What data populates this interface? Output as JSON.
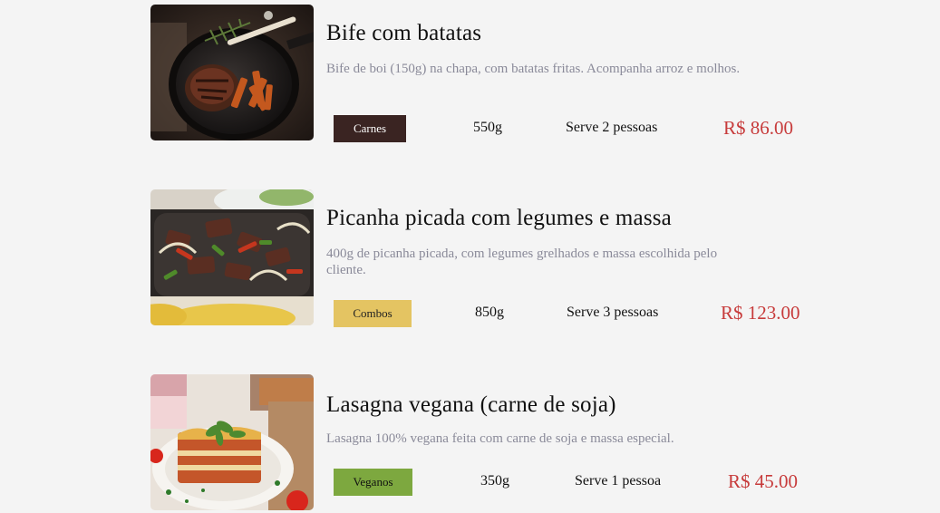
{
  "menu": {
    "items": [
      {
        "title": "Bife com batatas",
        "description": "Bife de boi (150g) na chapa, com batatas fritas. Acompanha arroz e molhos.",
        "category": "Carnes",
        "category_color": "#3a2422",
        "weight": "550g",
        "serves": "Serve 2 pessoas",
        "price": "R$ 86.00",
        "photo_icon": "steak-with-fries-photo"
      },
      {
        "title": "Picanha picada com legumes e massa",
        "description": "400g de picanha picada, com legumes grelhados e massa escolhida pelo cliente.",
        "category": "Combos",
        "category_color": "#e4c462",
        "weight": "850g",
        "serves": "Serve 3 pessoas",
        "price": "R$ 123.00",
        "photo_icon": "grilled-beef-vegetables-photo"
      },
      {
        "title": "Lasagna vegana (carne de soja)",
        "description": "Lasagna 100% vegana feita com carne de soja e massa especial.",
        "category": "Veganos",
        "category_color": "#7da83f",
        "weight": "350g",
        "serves": "Serve 1 pessoa",
        "price": "R$ 45.00",
        "photo_icon": "vegan-lasagna-photo"
      }
    ]
  },
  "colors": {
    "background": "#f4f4f4",
    "price": "#c73b3b",
    "description": "#8a8a99"
  }
}
